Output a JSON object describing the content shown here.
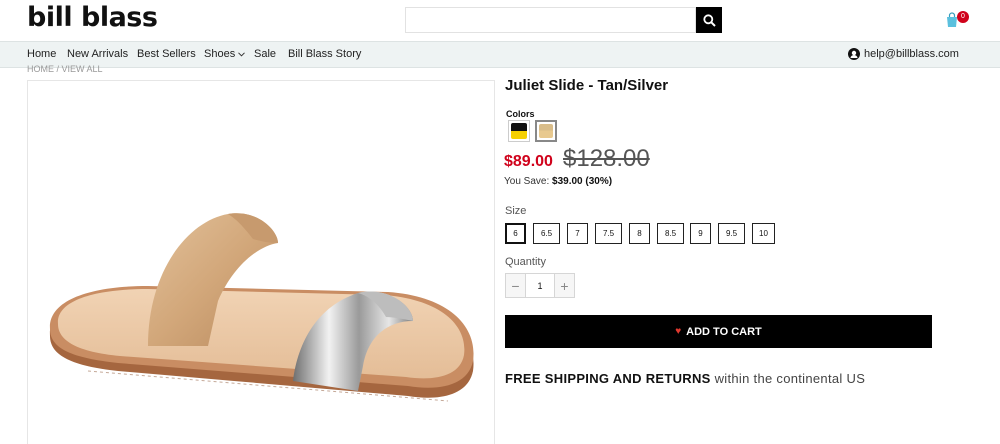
{
  "header": {
    "logo": "bill blass",
    "search": {
      "value": "",
      "placeholder": ""
    },
    "cart_count": "0"
  },
  "nav": {
    "items": [
      "Home",
      "New Arrivals",
      "Best Sellers",
      "Shoes",
      "Sale",
      "Bill Blass Story"
    ],
    "help_email": "help@billblass.com"
  },
  "breadcrumb": "HOME / VIEW ALL",
  "product": {
    "title": "Juliet Slide - Tan/Silver",
    "colors_label": "Colors",
    "swatches": [
      {
        "name": "black-yellow",
        "top": "#111111",
        "bottom": "#f5d000"
      },
      {
        "name": "tan",
        "top": "#d9bd8a",
        "bottom": "#e8c98f"
      }
    ],
    "sale_price": "$89.00",
    "original_price": "$128.00",
    "you_save_label": "You Save:",
    "you_save_value": "$39.00 (30%)",
    "size_label": "Size",
    "sizes": [
      "6",
      "6.5",
      "7",
      "7.5",
      "8",
      "8.5",
      "9",
      "9.5",
      "10"
    ],
    "selected_size": "6",
    "quantity_label": "Quantity",
    "quantity": "1",
    "qty_minus": "−",
    "qty_plus": "+",
    "add_to_cart": "ADD TO CART",
    "shipping_bold": "FREE SHIPPING AND RETURNS",
    "shipping_rest": "within the continental US"
  },
  "colors": {
    "sale_red": "#d0021b",
    "nav_bg": "#eef3f3",
    "button_black": "#000000"
  }
}
